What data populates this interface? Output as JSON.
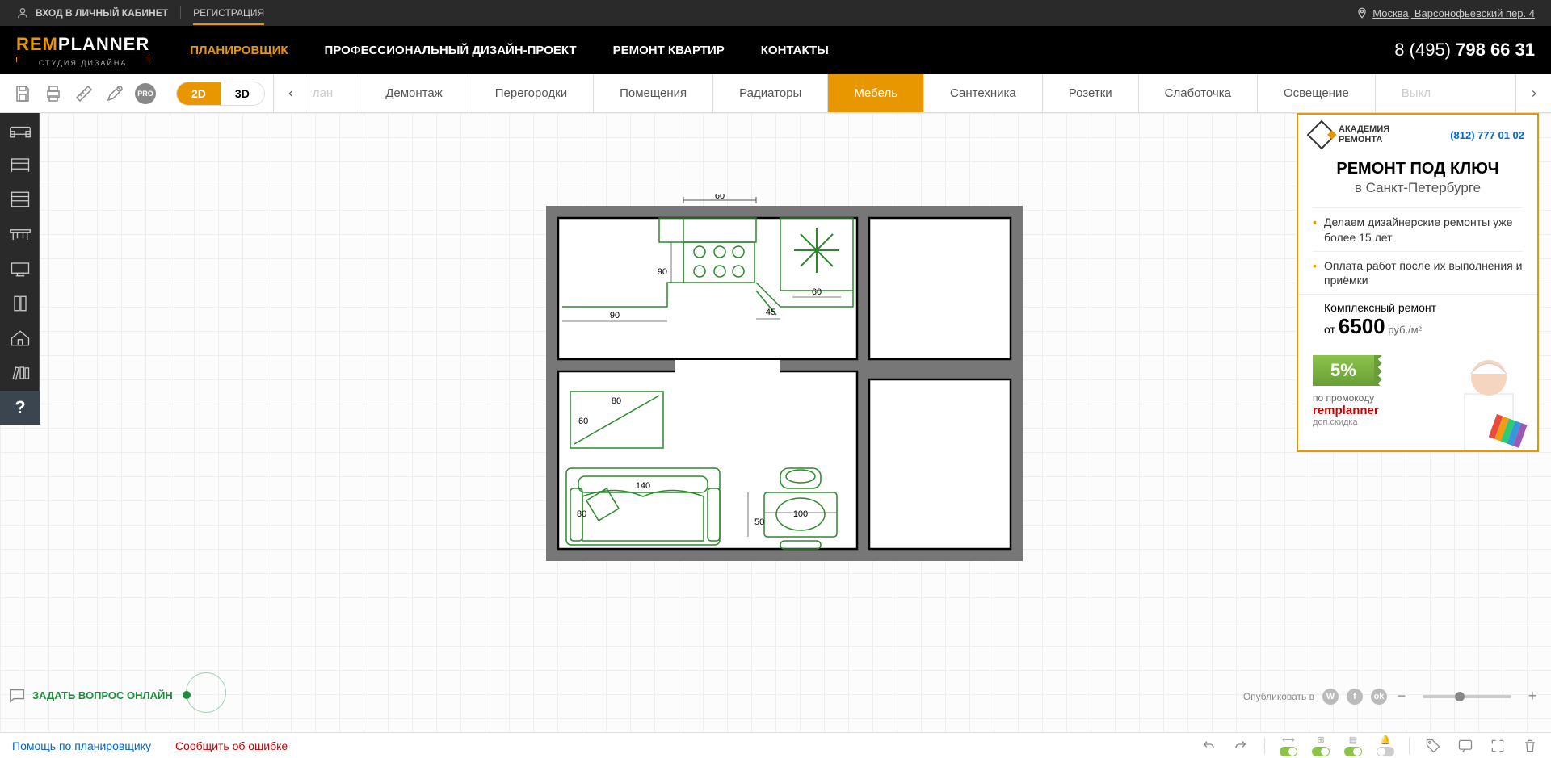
{
  "header": {
    "login": "ВХОД В ЛИЧНЫЙ КАБИНЕТ",
    "register": "РЕГИСТРАЦИЯ",
    "location": "Москва, Варсонофьевский пер. 4"
  },
  "logo": {
    "prefix": "REM",
    "main": "PLANNER",
    "sub": "СТУДИЯ ДИЗАЙНА"
  },
  "nav": {
    "items": [
      "ПЛАНИРОВЩИК",
      "ПРОФЕССИОНАЛЬНЫЙ ДИЗАЙН-ПРОЕКТ",
      "РЕМОНТ КВАРТИР",
      "КОНТАКТЫ"
    ],
    "active": 0
  },
  "phone": {
    "prefix": "8 (495) ",
    "main": "798 66 31"
  },
  "toolbar": {
    "pro": "PRO",
    "view2d": "2D",
    "view3d": "3D",
    "tabs": [
      "лан",
      "Демонтаж",
      "Перегородки",
      "Помещения",
      "Радиаторы",
      "Мебель",
      "Сантехника",
      "Розетки",
      "Слаботочка",
      "Освещение",
      "Выкл"
    ],
    "active": 5
  },
  "sidebar": {
    "help": "?"
  },
  "floorplan": {
    "dims": {
      "top60": "60",
      "d90a": "90",
      "d90b": "90",
      "d45": "45",
      "d60": "60",
      "tv80": "80",
      "tv60": "60",
      "sofa140": "140",
      "sofa80": "80",
      "table100": "100",
      "table50": "50"
    }
  },
  "ad": {
    "logo_line1": "АКАДЕМИЯ",
    "logo_line2": "РЕМОНТА",
    "phone": "(812) 777 01 02",
    "title": "РЕМОНТ ПОД КЛЮЧ",
    "subtitle": "в Санкт-Петербурге",
    "bullets": [
      "Делаем дизайнерские ремонты уже более 15 лет",
      "Оплата работ после их выполнения и приёмки"
    ],
    "price_label": "Комплексный ремонт",
    "price_from": "от ",
    "price": "6500",
    "price_unit": " руб./м²",
    "discount": "5%",
    "promo_label": "по промокоду",
    "promo_code": "remplanner",
    "promo_extra": "доп.скидка"
  },
  "chat": {
    "label": "ЗАДАТЬ ВОПРОС ОНЛАЙН"
  },
  "publish": {
    "label": "Опубликовать в"
  },
  "footer": {
    "help": "Помощь по планировщику",
    "report": "Сообщить об ошибке"
  }
}
